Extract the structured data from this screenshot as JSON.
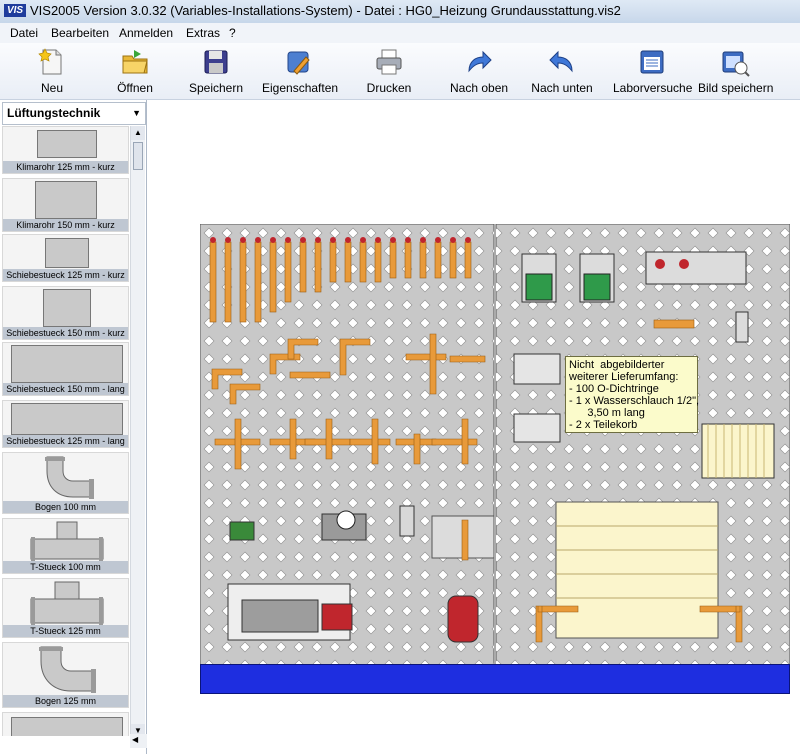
{
  "window": {
    "app_badge": "VIS",
    "title": "VIS2005 Version 3.0.32 (Variables-Installations-System) - Datei : HG0_Heizung Grundausstattung.vis2"
  },
  "menu": [
    "Datei",
    "Bearbeiten",
    "Anmelden",
    "Extras",
    "?"
  ],
  "toolbar": {
    "new": "Neu",
    "open": "Öffnen",
    "save": "Speichern",
    "properties": "Eigenschaften",
    "print": "Drucken",
    "move_up": "Nach oben",
    "move_down": "Nach unten",
    "lab": "Laborversuche",
    "save_image": "Bild speichern"
  },
  "sidebar": {
    "category": "Lüftungstechnik",
    "items": [
      "Klimarohr 125 mm - kurz",
      "Klimarohr 150 mm - kurz",
      "Schiebestueck 125 mm - kurz",
      "Schiebestueck 150 mm - kurz",
      "Schiebestueck 150 mm - lang",
      "Schiebestueck 125 mm - lang",
      "Bogen 100 mm",
      "T-Stueck 100 mm",
      "T-Stueck 125 mm",
      "Bogen 125 mm"
    ]
  },
  "tooltip": {
    "lines": [
      "Nicht  abgebilderter",
      "weiterer Lieferumfang:",
      "- 100 O-Dichtringe",
      "- 1 x Wasserschlauch 1/2\",",
      "      3,50 m lang",
      "- 2 x Teilekorb"
    ]
  },
  "colors": {
    "board": "#c8c8c8",
    "pipe": "#e89a3a",
    "valve_red": "#c0262d",
    "base": "#1e2ee0",
    "tooltip_bg": "#fbfbcb"
  }
}
